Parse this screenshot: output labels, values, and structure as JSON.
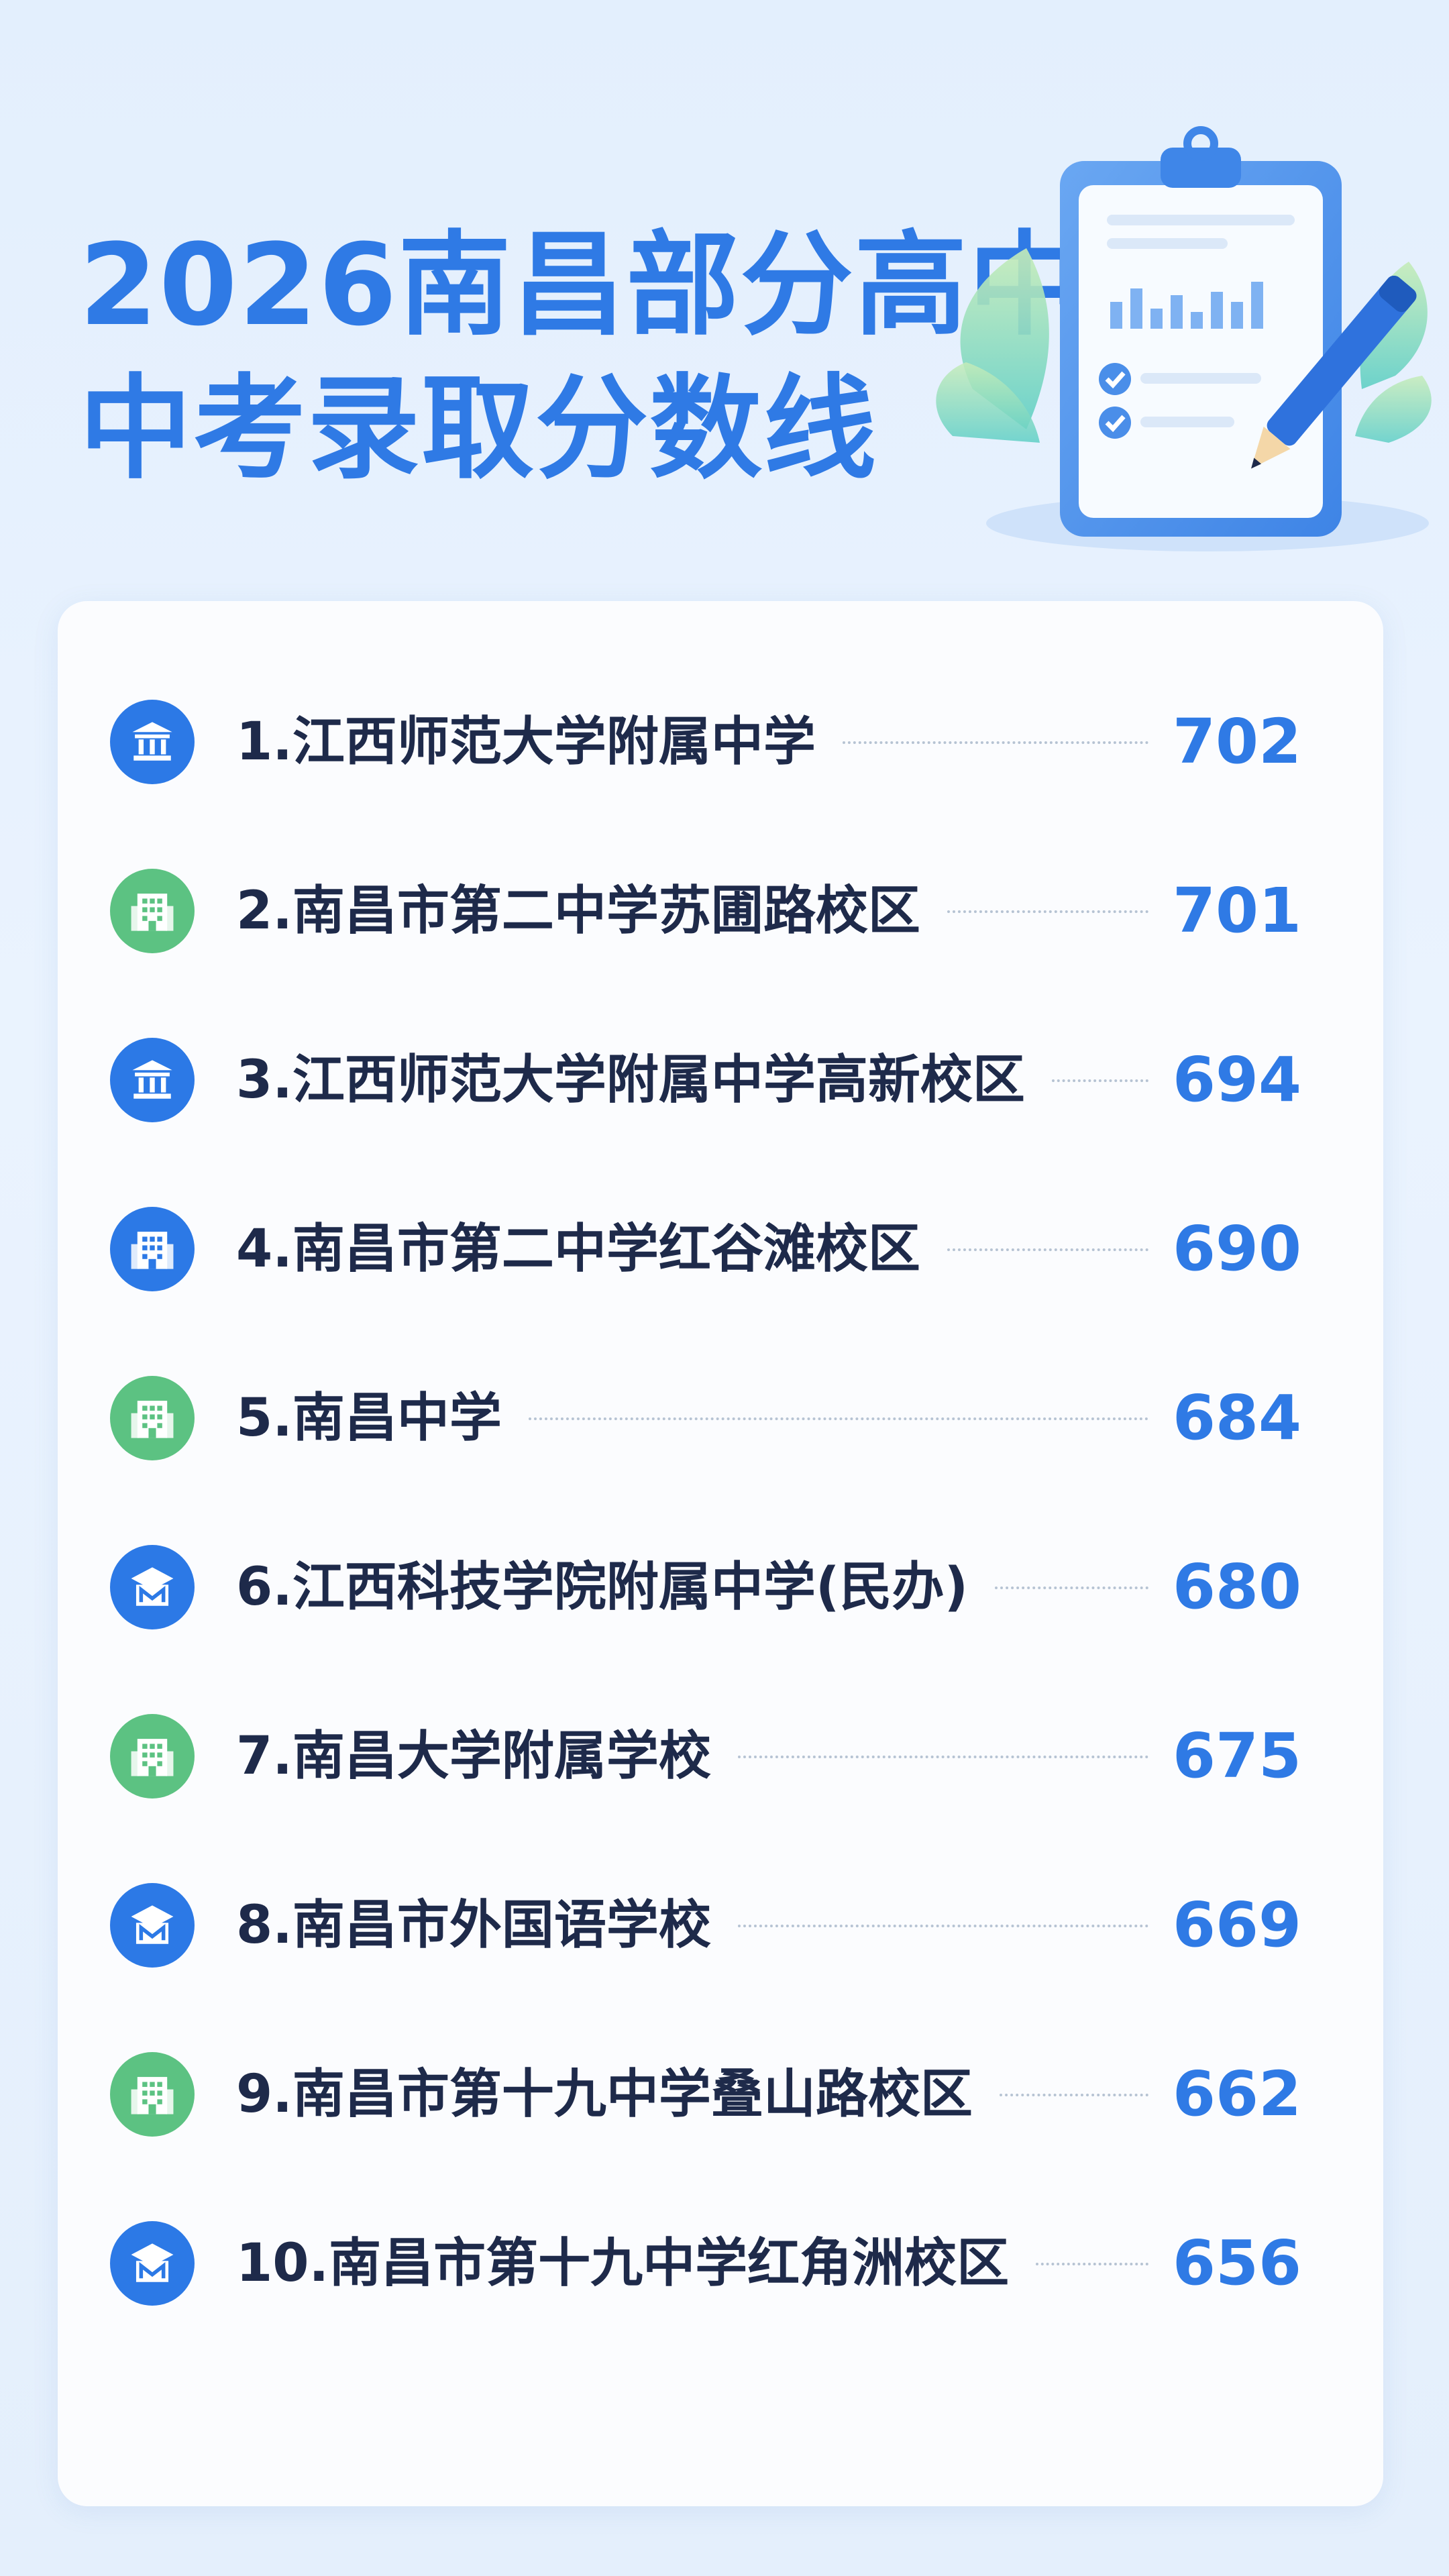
{
  "title": {
    "line1": "2026南昌部分高中",
    "line2": "中考录取分数线"
  },
  "colors": {
    "accent": "#2f7ae5",
    "badge_blue": "#2c79e6",
    "badge_green": "#5cc282",
    "text": "#1e2a4a"
  },
  "schools": [
    {
      "name": "1.江西师范大学附属中学",
      "score": "702",
      "icon": "institution-icon",
      "color": "blue"
    },
    {
      "name": "2.南昌市第二中学苏圃路校区",
      "score": "701",
      "icon": "school-building-icon",
      "color": "green"
    },
    {
      "name": "3.江西师范大学附属中学高新校区",
      "score": "694",
      "icon": "institution-icon",
      "color": "blue"
    },
    {
      "name": "4.南昌市第二中学红谷滩校区",
      "score": "690",
      "icon": "school-building-icon",
      "color": "blue"
    },
    {
      "name": "5.南昌中学",
      "score": "684",
      "icon": "school-building-icon",
      "color": "green"
    },
    {
      "name": "6.江西科技学院附属中学(民办)",
      "score": "680",
      "icon": "academy-icon",
      "color": "blue"
    },
    {
      "name": "7.南昌大学附属学校",
      "score": "675",
      "icon": "school-building-icon",
      "color": "green"
    },
    {
      "name": "8.南昌市外国语学校",
      "score": "669",
      "icon": "academy-icon",
      "color": "blue"
    },
    {
      "name": "9.南昌市第十九中学叠山路校区",
      "score": "662",
      "icon": "school-building-icon",
      "color": "green"
    },
    {
      "name": "10.南昌市第十九中学红角洲校区",
      "score": "656",
      "icon": "academy-icon",
      "color": "blue"
    }
  ]
}
